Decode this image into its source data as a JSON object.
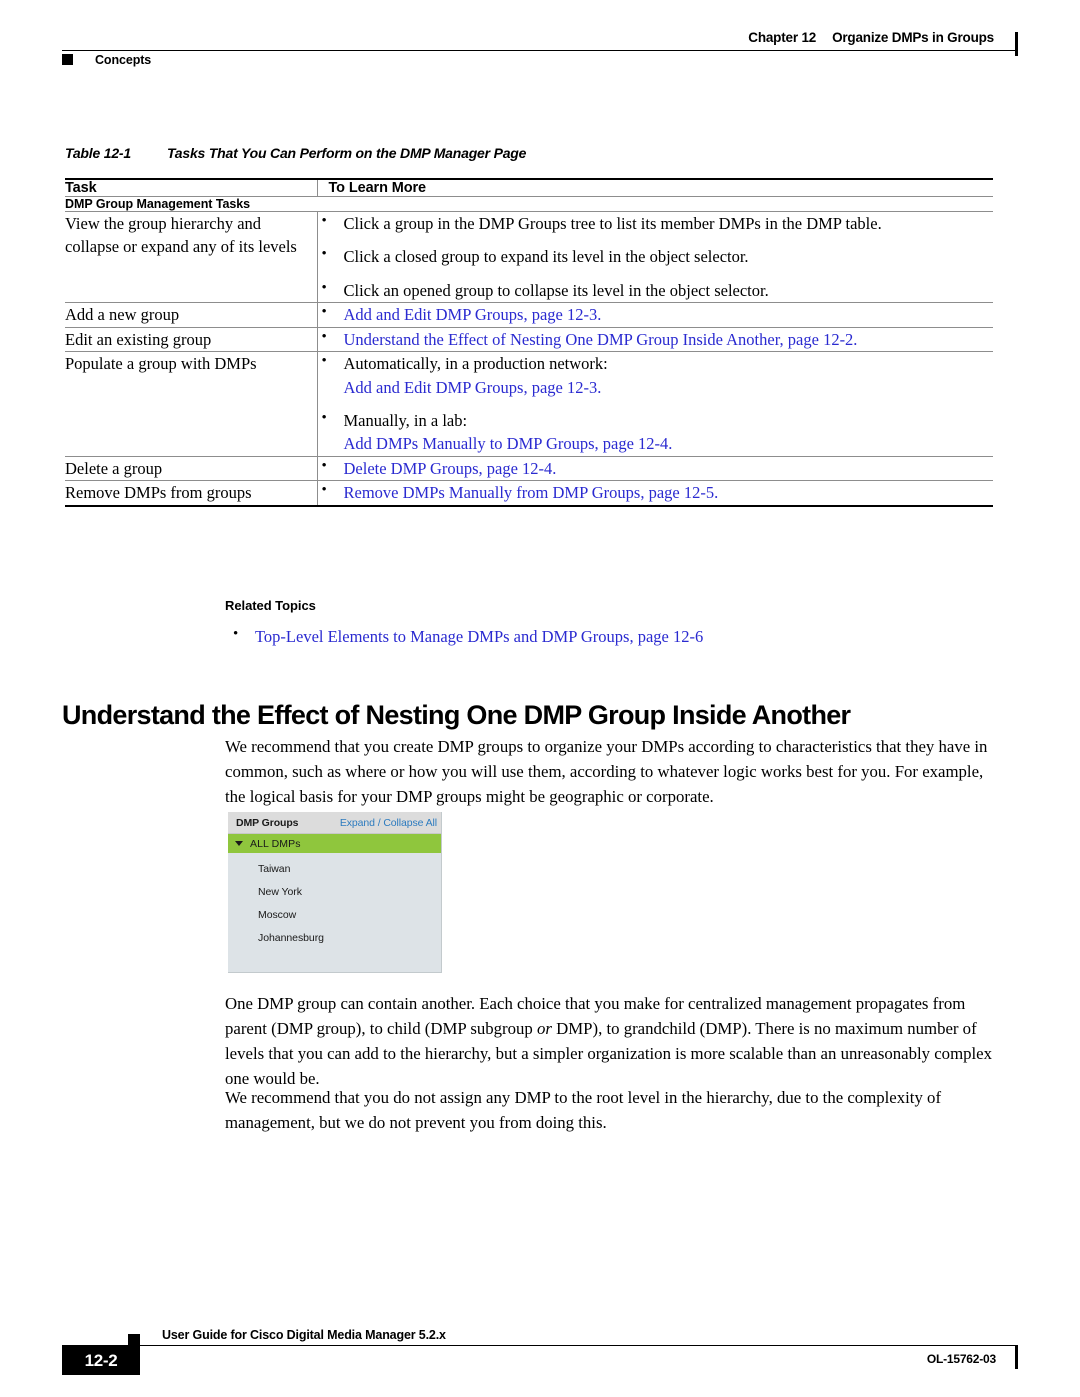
{
  "header": {
    "chapter": "Chapter 12",
    "chapter_title": "Organize DMPs in Groups",
    "section": "Concepts"
  },
  "table": {
    "caption_number": "Table 12-1",
    "caption_text": "Tasks That You Can Perform on the DMP Manager Page",
    "columns": [
      "Task",
      "To Learn More"
    ],
    "group_header": "DMP Group Management Tasks",
    "rows": [
      {
        "task": "View the group hierarchy and collapse or expand any of its levels",
        "items": [
          {
            "text": "Click a group in the DMP Groups tree to list its member DMPs in the DMP table.",
            "link": false
          },
          {
            "text": "Click a closed group to expand its level in the object selector.",
            "link": false
          },
          {
            "text": "Click an opened group to collapse its level in the object selector.",
            "link": false
          }
        ]
      },
      {
        "task": "Add a new group",
        "items": [
          {
            "text": "Add and Edit DMP Groups, page 12-3.",
            "link": true
          }
        ]
      },
      {
        "task": "Edit an existing group",
        "items": [
          {
            "text": "Understand the Effect of Nesting One DMP Group Inside Another, page 12-2.",
            "link": true
          }
        ]
      },
      {
        "task": "Populate a group with DMPs",
        "items": [
          {
            "text": "Automatically, in a production network:",
            "link": false,
            "sub": "Add and Edit DMP Groups, page 12-3."
          },
          {
            "text": "Manually, in a lab:",
            "link": false,
            "sub": "Add DMPs Manually to DMP Groups, page 12-4."
          }
        ]
      },
      {
        "task": "Delete a group",
        "items": [
          {
            "text": "Delete DMP Groups, page 12-4.",
            "link": true,
            "bullet": false
          }
        ]
      },
      {
        "task": "Remove DMPs from groups",
        "items": [
          {
            "text": "Remove DMPs Manually from DMP Groups, page 12-5.",
            "link": true,
            "bullet": false
          }
        ]
      }
    ]
  },
  "related_topics": {
    "title": "Related Topics",
    "items": [
      "Top-Level Elements to Manage DMPs and DMP Groups, page 12-6"
    ]
  },
  "heading": "Understand the Effect of Nesting One DMP Group Inside Another",
  "paragraphs": {
    "p1": "We recommend that you create DMP groups to organize your DMPs according to characteristics that they have in common, such as where or how you will use them, according to whatever logic works best for you. For example, the logical basis for your DMP groups might be geographic or corporate.",
    "p2_a": "One DMP group can contain another. Each choice that you make for centralized management propagates from parent (DMP group), to child (DMP subgroup ",
    "p2_em": "or",
    "p2_b": " DMP), to grandchild (DMP). There is no maximum number of levels that you can add to the hierarchy, but a simpler organization is more scalable than an unreasonably complex one would be.",
    "p3": "We recommend that you do not assign any DMP to the root level in the hierarchy, due to the complexity of management, but we do not prevent you from doing this."
  },
  "widget": {
    "title": "DMP Groups",
    "expand_collapse_label": "Expand / Collapse All",
    "root_label": "ALL DMPs",
    "children": [
      "Taiwan",
      "New York",
      "Moscow",
      "Johannesburg"
    ],
    "colors": {
      "root_green": "#8fc63d",
      "panel_bg": "#dde3e7",
      "header_bg": "#dcdcdc",
      "link_blue": "#2c7bbf"
    }
  },
  "footer": {
    "page_number": "12-2",
    "guide_title": "User Guide for Cisco Digital Media Manager 5.2.x",
    "doc_number": "OL-15762-03"
  },
  "colors": {
    "link": "#2a2ad0",
    "rule": "#000000"
  }
}
